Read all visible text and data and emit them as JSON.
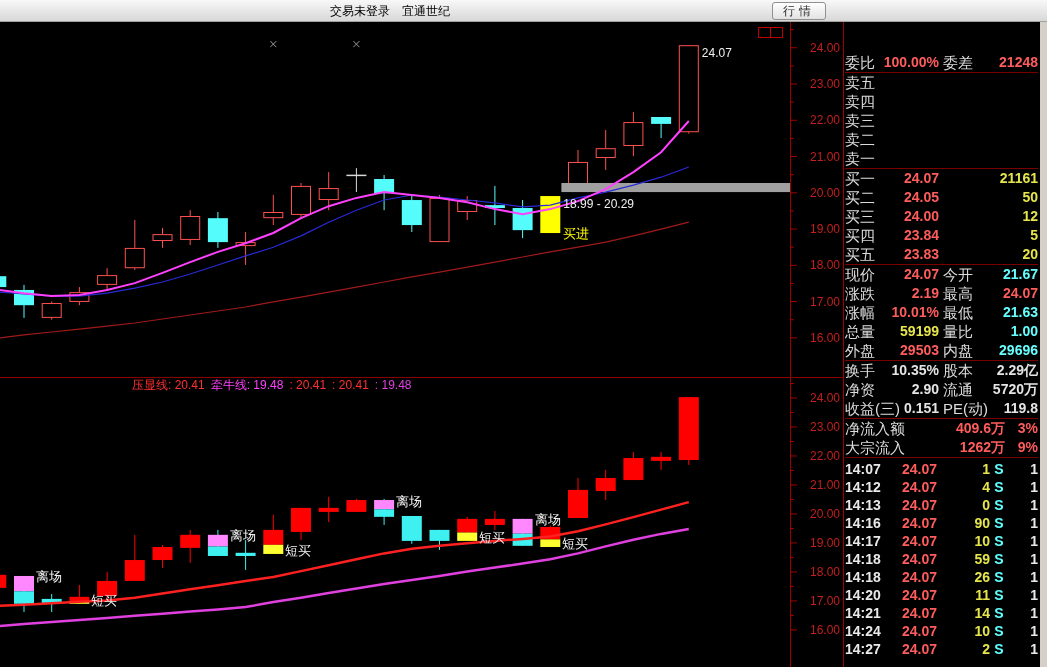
{
  "title_bar": {
    "status": "交易未登录",
    "stock_name": "宜通世纪",
    "button": "行情"
  },
  "price_chart": {
    "axis_labels": [
      "24.00",
      "23.00",
      "22.00",
      "21.00",
      "20.00",
      "19.00",
      "18.00",
      "17.00",
      "16.00"
    ],
    "candles": [
      {
        "kind": "down"
      },
      {
        "kind": "down"
      },
      {
        "kind": "up"
      },
      {
        "kind": "up"
      },
      {
        "kind": "up"
      },
      {
        "kind": "up"
      },
      {
        "kind": "up"
      },
      {
        "kind": "up"
      },
      {
        "kind": "down"
      },
      {
        "kind": "up"
      },
      {
        "kind": "up"
      },
      {
        "kind": "up"
      },
      {
        "kind": "up"
      },
      {
        "kind": "flat"
      },
      {
        "kind": "down"
      },
      {
        "kind": "down"
      },
      {
        "kind": "up"
      },
      {
        "kind": "up"
      },
      {
        "kind": "down"
      },
      {
        "kind": "down"
      },
      {
        "kind": "signal",
        "labels": [
          {
            "text": "18.99 - 20.29",
            "kind": "value"
          },
          {
            "text": "买进",
            "kind": "signal"
          }
        ]
      },
      {
        "kind": "up"
      },
      {
        "kind": "up"
      },
      {
        "kind": "up"
      },
      {
        "kind": "down"
      },
      {
        "kind": "up",
        "labels": [
          {
            "text": "24.07",
            "kind": "value"
          }
        ]
      }
    ]
  },
  "indicator_chart": {
    "legend": [
      {
        "text": "压显线: 20.41",
        "color": "#ff3030"
      },
      {
        "text": "牵牛线: 19.48",
        "color": "#ff40ff"
      },
      {
        "text": ": 20.41",
        "color": "#ff3030"
      },
      {
        "text": ": 20.41",
        "color": "#ff3030"
      },
      {
        "text": ": 19.48",
        "color": "#e040e0"
      }
    ],
    "axis_labels": [
      "24.00",
      "23.00",
      "22.00",
      "21.00",
      "20.00",
      "19.00",
      "18.00",
      "17.00",
      "16.00"
    ],
    "candles": [
      {
        "kind": "up"
      },
      {
        "kind": "exit",
        "label": "离场"
      },
      {
        "kind": "down"
      },
      {
        "kind": "short_buy",
        "label": "短买"
      },
      {
        "kind": "up"
      },
      {
        "kind": "up"
      },
      {
        "kind": "up"
      },
      {
        "kind": "up"
      },
      {
        "kind": "exit",
        "label": "离场"
      },
      {
        "kind": "down"
      },
      {
        "kind": "short_buy",
        "label": "短买"
      },
      {
        "kind": "up"
      },
      {
        "kind": "up"
      },
      {
        "kind": "up"
      },
      {
        "kind": "exit",
        "label": "离场"
      },
      {
        "kind": "down"
      },
      {
        "kind": "down"
      },
      {
        "kind": "short_buy",
        "label": "短买"
      },
      {
        "kind": "up"
      },
      {
        "kind": "exit",
        "label": "离场"
      },
      {
        "kind": "short_buy",
        "label": "短买"
      },
      {
        "kind": "up"
      },
      {
        "kind": "up"
      },
      {
        "kind": "up"
      },
      {
        "kind": "up"
      },
      {
        "kind": "up"
      }
    ]
  },
  "quote_panel": {
    "ratio": [
      {
        "label": "委比",
        "value": "100.00%",
        "color": "#ff5c5c"
      },
      {
        "label": "委差",
        "value": "21248",
        "color": "#ff5c5c"
      }
    ],
    "asks": [
      {
        "label": "卖五"
      },
      {
        "label": "卖四"
      },
      {
        "label": "卖三"
      },
      {
        "label": "卖二"
      },
      {
        "label": "卖一"
      }
    ],
    "bids": [
      {
        "label": "买一",
        "price": "24.07",
        "volume": "21161"
      },
      {
        "label": "买二",
        "price": "24.05",
        "volume": "50"
      },
      {
        "label": "买三",
        "price": "24.00",
        "volume": "12"
      },
      {
        "label": "买四",
        "price": "23.84",
        "volume": "5"
      },
      {
        "label": "买五",
        "price": "23.83",
        "volume": "20"
      }
    ],
    "quote": [
      [
        {
          "label": "现价",
          "value": "24.07",
          "color": "#ff5c5c"
        },
        {
          "label": "今开",
          "value": "21.67",
          "color": "#66ffff"
        }
      ],
      [
        {
          "label": "涨跌",
          "value": "2.19",
          "color": "#ff5c5c"
        },
        {
          "label": "最高",
          "value": "24.07",
          "color": "#ff5c5c"
        }
      ],
      [
        {
          "label": "涨幅",
          "value": "10.01%",
          "color": "#ff5c5c"
        },
        {
          "label": "最低",
          "value": "21.63",
          "color": "#66ffff"
        }
      ],
      [
        {
          "label": "总量",
          "value": "59199",
          "color": "#e6e64c"
        },
        {
          "label": "量比",
          "value": "1.00",
          "color": "#66ffff"
        }
      ],
      [
        {
          "label": "外盘",
          "value": "29503",
          "color": "#ff5c5c"
        },
        {
          "label": "内盘",
          "value": "29696",
          "color": "#66ffff"
        }
      ]
    ],
    "fundamentals": [
      [
        {
          "label": "换手",
          "value": "10.35%"
        },
        {
          "label": "股本",
          "value": "2.29亿"
        }
      ],
      [
        {
          "label": "净资",
          "value": "2.90"
        },
        {
          "label": "流通",
          "value": "5720万"
        }
      ],
      [
        {
          "label": "收益(三)",
          "value": "0.151"
        },
        {
          "label": "PE(动)",
          "value": "119.8"
        }
      ]
    ],
    "fund_flow": [
      {
        "label": "净流入额",
        "amount": "409.6万",
        "percent": "3%"
      },
      {
        "label": "大宗流入",
        "amount": "1262万",
        "percent": "9%"
      }
    ],
    "ticks": [
      {
        "time": "14:07",
        "price": "24.07",
        "volume": "1",
        "side": "S",
        "count": "1"
      },
      {
        "time": "14:12",
        "price": "24.07",
        "volume": "4",
        "side": "S",
        "count": "1"
      },
      {
        "time": "14:13",
        "price": "24.07",
        "volume": "0",
        "side": "S",
        "count": "1"
      },
      {
        "time": "14:16",
        "price": "24.07",
        "volume": "90",
        "side": "S",
        "count": "1"
      },
      {
        "time": "14:17",
        "price": "24.07",
        "volume": "10",
        "side": "S",
        "count": "1"
      },
      {
        "time": "14:18",
        "price": "24.07",
        "volume": "59",
        "side": "S",
        "count": "1"
      },
      {
        "time": "14:18",
        "price": "24.07",
        "volume": "26",
        "side": "S",
        "count": "1"
      },
      {
        "time": "14:20",
        "price": "24.07",
        "volume": "11",
        "side": "S",
        "count": "1"
      },
      {
        "time": "14:21",
        "price": "24.07",
        "volume": "14",
        "side": "S",
        "count": "1"
      },
      {
        "time": "14:24",
        "price": "24.07",
        "volume": "10",
        "side": "S",
        "count": "1"
      },
      {
        "time": "14:27",
        "price": "24.07",
        "volume": "2",
        "side": "S",
        "count": "1"
      }
    ]
  }
}
